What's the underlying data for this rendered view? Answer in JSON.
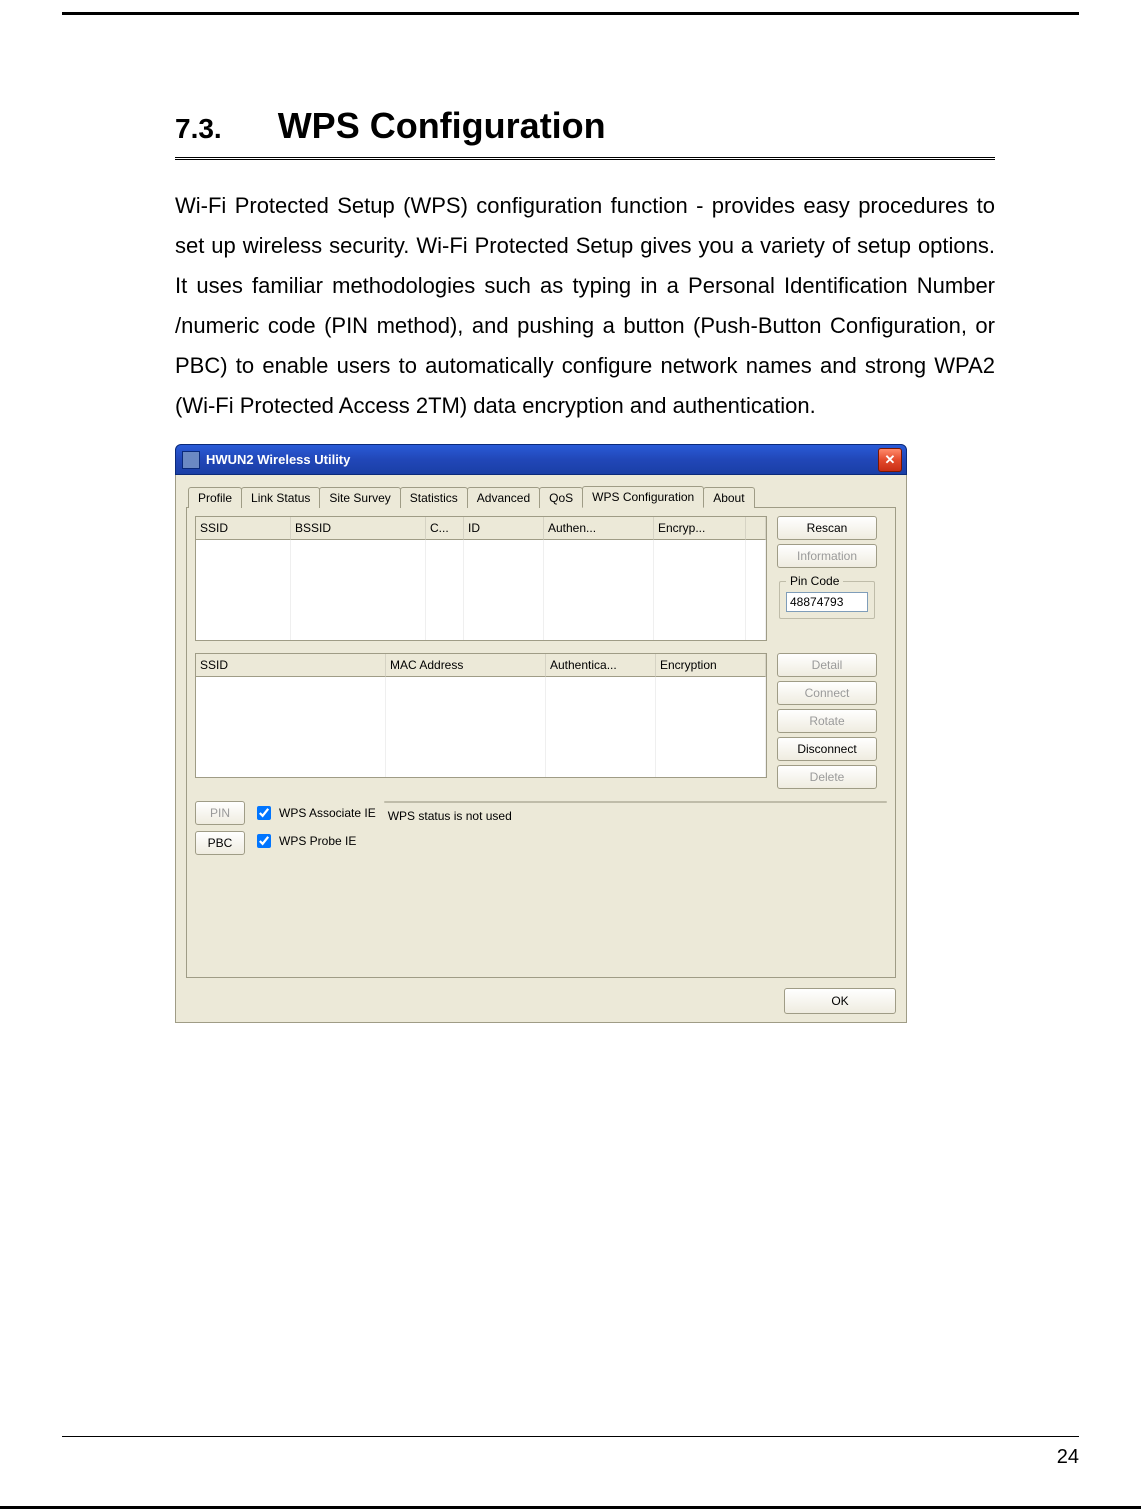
{
  "doc": {
    "section_number": "7.3.",
    "section_title": "WPS Configuration",
    "paragraph": "Wi-Fi Protected Setup (WPS) configuration function - provides easy procedures to set up wireless security. Wi-Fi Protected Setup gives you a variety of setup options. It uses familiar methodologies such as typing in a Personal Identification Number /numeric code (PIN method), and pushing a button (Push-Button Configuration, or PBC) to enable users to automatically configure network names and strong WPA2 (Wi-Fi Protected Access 2TM) data encryption and authentication.",
    "page_number": "24"
  },
  "window": {
    "title": "HWUN2 Wireless Utility",
    "tabs": [
      "Profile",
      "Link Status",
      "Site Survey",
      "Statistics",
      "Advanced",
      "QoS",
      "WPS Configuration",
      "About"
    ],
    "active_tab": "WPS Configuration",
    "table1_headers": [
      "SSID",
      "BSSID",
      "C...",
      "ID",
      "Authen...",
      "Encryp..."
    ],
    "table2_headers": [
      "SSID",
      "MAC Address",
      "Authentica...",
      "Encryption"
    ],
    "buttons": {
      "rescan": "Rescan",
      "information": "Information",
      "detail": "Detail",
      "connect": "Connect",
      "rotate": "Rotate",
      "disconnect": "Disconnect",
      "delete": "Delete",
      "pin": "PIN",
      "pbc": "PBC",
      "ok": "OK"
    },
    "pin_group_label": "Pin Code",
    "pin_code_value": "48874793",
    "checkboxes": {
      "associate": "WPS Associate IE",
      "probe": "WPS Probe IE"
    },
    "status_text": "WPS status is not used"
  }
}
